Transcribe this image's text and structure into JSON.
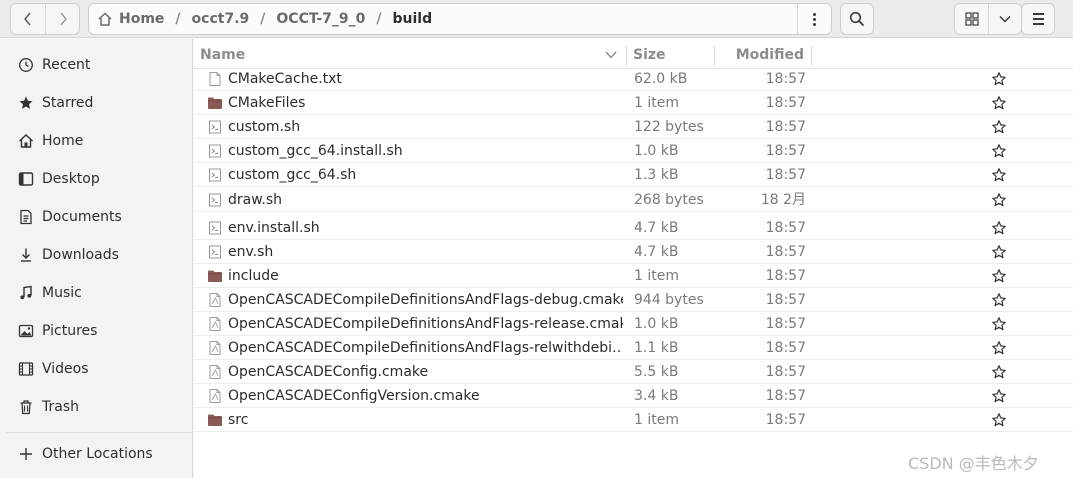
{
  "header": {
    "breadcrumbs": [
      "Home",
      "occt7.9",
      "OCCT-7_9_0",
      "build"
    ],
    "separator": "/"
  },
  "sidebar": {
    "items": [
      {
        "label": "Recent",
        "icon": "clock-icon"
      },
      {
        "label": "Starred",
        "icon": "star-icon"
      },
      {
        "label": "Home",
        "icon": "home-icon"
      },
      {
        "label": "Desktop",
        "icon": "desktop-icon"
      },
      {
        "label": "Documents",
        "icon": "document-icon"
      },
      {
        "label": "Downloads",
        "icon": "download-icon"
      },
      {
        "label": "Music",
        "icon": "music-icon"
      },
      {
        "label": "Pictures",
        "icon": "picture-icon"
      },
      {
        "label": "Videos",
        "icon": "video-icon"
      },
      {
        "label": "Trash",
        "icon": "trash-icon"
      }
    ],
    "other_locations": {
      "label": "Other Locations",
      "icon": "plus-icon"
    }
  },
  "list": {
    "columns": {
      "name": "Name",
      "size": "Size",
      "modified": "Modified"
    },
    "rows": [
      {
        "name": "CMakeCache.txt",
        "size": "62.0 kB",
        "modified": "18:57",
        "type": "text"
      },
      {
        "name": "CMakeFiles",
        "size": "1 item",
        "modified": "18:57",
        "type": "folder"
      },
      {
        "name": "custom.sh",
        "size": "122 bytes",
        "modified": "18:57",
        "type": "script"
      },
      {
        "name": "custom_gcc_64.install.sh",
        "size": "1.0 kB",
        "modified": "18:57",
        "type": "script"
      },
      {
        "name": "custom_gcc_64.sh",
        "size": "1.3 kB",
        "modified": "18:57",
        "type": "script"
      },
      {
        "name": "draw.sh",
        "size": "268 bytes",
        "modified": "18 2月",
        "type": "script"
      },
      {
        "name": "env.install.sh",
        "size": "4.7 kB",
        "modified": "18:57",
        "type": "script"
      },
      {
        "name": "env.sh",
        "size": "4.7 kB",
        "modified": "18:57",
        "type": "script"
      },
      {
        "name": "include",
        "size": "1 item",
        "modified": "18:57",
        "type": "folder"
      },
      {
        "name": "OpenCASCADECompileDefinitionsAndFlags-debug.cmake",
        "size": "944 bytes",
        "modified": "18:57",
        "type": "cmake"
      },
      {
        "name": "OpenCASCADECompileDefinitionsAndFlags-release.cmake",
        "size": "1.0 kB",
        "modified": "18:57",
        "type": "cmake"
      },
      {
        "name": "OpenCASCADECompileDefinitionsAndFlags-relwithdebi…",
        "size": "1.1 kB",
        "modified": "18:57",
        "type": "cmake"
      },
      {
        "name": "OpenCASCADEConfig.cmake",
        "size": "5.5 kB",
        "modified": "18:57",
        "type": "cmake"
      },
      {
        "name": "OpenCASCADEConfigVersion.cmake",
        "size": "3.4 kB",
        "modified": "18:57",
        "type": "cmake"
      },
      {
        "name": "src",
        "size": "1 item",
        "modified": "18:57",
        "type": "folder"
      }
    ]
  },
  "watermark": "CSDN @丰色木夕",
  "colors": {
    "folder": "#8a5a55",
    "accent": "#e95420"
  }
}
